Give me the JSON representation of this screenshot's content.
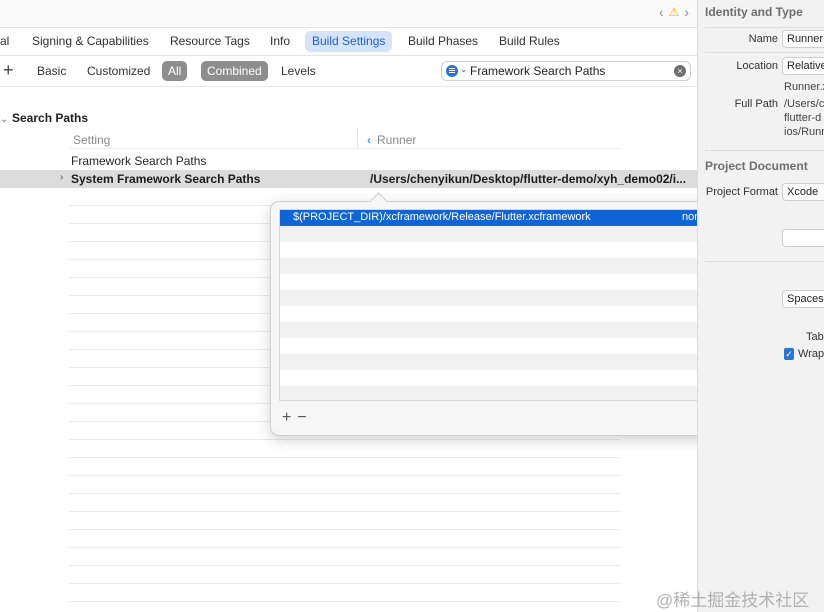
{
  "nav": {
    "back": "‹",
    "warning": "⚠",
    "forward": "›"
  },
  "tabs": [
    {
      "label": "al"
    },
    {
      "label": "Signing & Capabilities"
    },
    {
      "label": "Resource Tags"
    },
    {
      "label": "Info"
    },
    {
      "label": "Build Settings"
    },
    {
      "label": "Build Phases"
    },
    {
      "label": "Build Rules"
    }
  ],
  "filter": {
    "add": "+",
    "basic": "Basic",
    "customized": "Customized",
    "all": "All",
    "combined": "Combined",
    "levels": "Levels"
  },
  "search": {
    "value": "Framework Search Paths",
    "clear": "×"
  },
  "section": {
    "title": "Search Paths"
  },
  "columns": {
    "setting": "Setting",
    "runner": "Runner"
  },
  "rows": {
    "group": "Framework Search Paths",
    "selected_name": "System Framework Search Paths",
    "selected_value": "/Users/chenyikun/Desktop/flutter-demo/xyh_demo02/i..."
  },
  "popover": {
    "entry_path": "$(PROJECT_DIR)/xcframework/Release/Flutter.xcframework",
    "entry_mode": "non-recursive",
    "add": "+",
    "remove": "−"
  },
  "inspector": {
    "identity_title": "Identity and Type",
    "name_label": "Name",
    "name_value": "Runner",
    "location_label": "Location",
    "location_value": "Relative",
    "runner_file": "Runner.x",
    "full_path_label": "Full Path",
    "full_path_lines": [
      "/Users/c",
      "flutter-d",
      "ios/Runn"
    ],
    "project_doc_title": "Project Document",
    "project_format_label": "Project Format",
    "project_format_value": "Xcode",
    "indent_value": "Spaces",
    "tab_label": "Tab",
    "wrap_label": "Wrap"
  },
  "watermark": "@稀土掘金技术社区",
  "colors": {
    "accent": "#1164d6",
    "tab_active_bg": "#d6e4fb",
    "selected_row": "#dcdcdc"
  }
}
